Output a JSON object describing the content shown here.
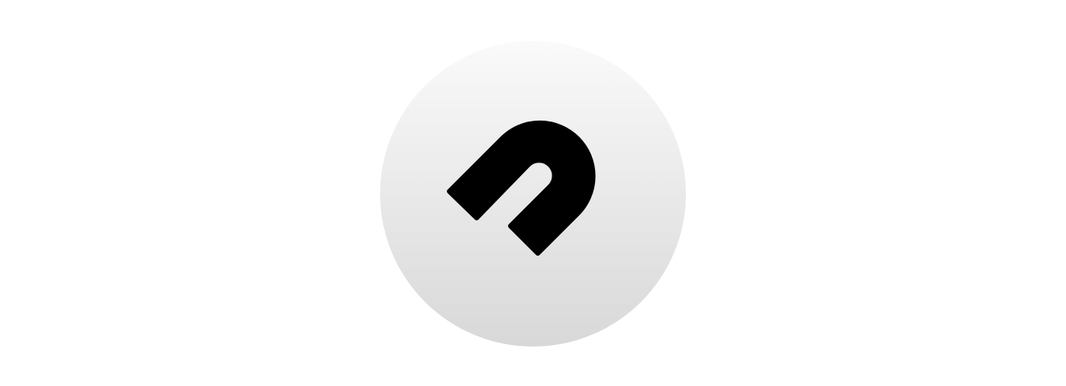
{
  "logo": {
    "icon": "magnet-icon",
    "colors": {
      "badge_top": "#fafafa",
      "badge_bottom": "#d8d8d8",
      "glyph": "#000000",
      "background": "#ffffff"
    }
  }
}
